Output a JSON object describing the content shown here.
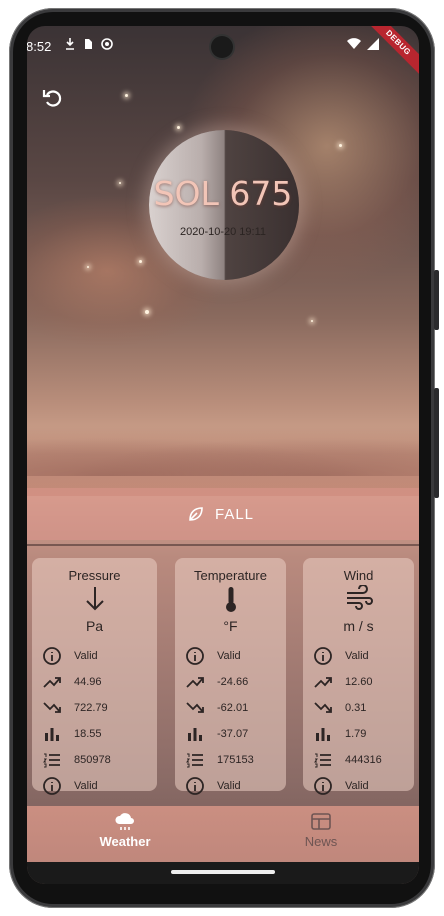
{
  "status_bar": {
    "time": "8:52",
    "debug_label": "DEBUG"
  },
  "header": {
    "sol_title": "SOL 675",
    "date": "2020-10-20 19:11"
  },
  "season": {
    "label": "FALL"
  },
  "cards": [
    {
      "title": "Pressure",
      "unit": "Pa",
      "validity": "Valid",
      "max": "44.96",
      "min": "722.79",
      "avg": "18.55",
      "count": "850978",
      "validity2": "Valid",
      "icon": "arrow-down-icon"
    },
    {
      "title": "Temperature",
      "unit": "°F",
      "validity": "Valid",
      "max": "-24.66",
      "min": "-62.01",
      "avg": "-37.07",
      "count": "175153",
      "validity2": "Valid",
      "icon": "thermometer-icon"
    },
    {
      "title": "Wind",
      "unit": "m / s",
      "validity": "Valid",
      "max": "12.60",
      "min": "0.31",
      "avg": "1.79",
      "count": "444316",
      "validity2": "Valid",
      "icon": "wind-icon"
    }
  ],
  "nav": {
    "weather": "Weather",
    "news": "News"
  },
  "colors": {
    "accent": "#f2c5b7",
    "nav_active": "#ffffff",
    "nav_inactive": "#6e5553"
  }
}
